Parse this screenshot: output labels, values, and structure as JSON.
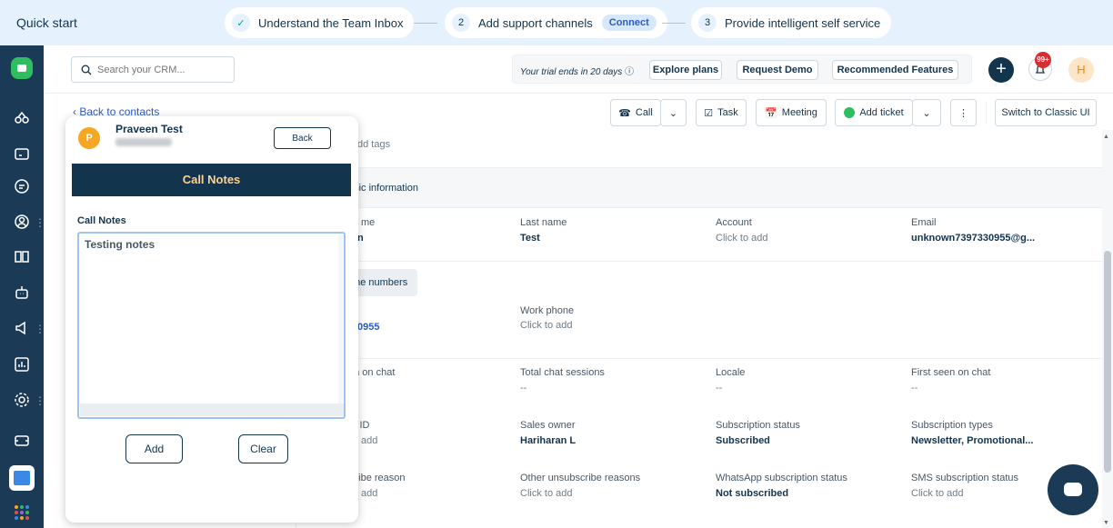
{
  "quickstart": {
    "title": "Quick start",
    "step1": "Understand the Team Inbox",
    "step2_num": "2",
    "step2": "Add support channels",
    "step2_badge": "Connect",
    "step3_num": "3",
    "step3": "Provide intelligent self service"
  },
  "header": {
    "search_placeholder": "Search your CRM...",
    "trial_text": "Your trial ends in 20 days",
    "explore": "Explore plans",
    "demo": "Request Demo",
    "features": "Recommended Features",
    "notif_count": "99+",
    "avatar_initial": "H"
  },
  "toolbar": {
    "back": "Back to contacts",
    "call": "Call",
    "task": "Task",
    "meeting": "Meeting",
    "add_ticket": "Add ticket",
    "classic": "Switch to Classic UI"
  },
  "contact": {
    "add_tags": "dd tags",
    "basic_info": "asic information",
    "first_name_label": "me",
    "first_name_value": "n",
    "last_name_label": "Last name",
    "last_name_value": "Test",
    "account_label": "Account",
    "account_value": "Click to add",
    "email_label": "Email",
    "email_value": "unknown7397330955@g...",
    "phone_numbers": "one numbers",
    "mobile_value": "0955",
    "work_phone_label": "Work phone",
    "work_phone_value": "Click to add",
    "last_seen_label": "en on chat",
    "total_chat_label": "Total chat sessions",
    "total_chat_value": "--",
    "locale_label": "Locale",
    "locale_value": "--",
    "first_seen_label": "First seen on chat",
    "first_seen_value": "--",
    "id_label": "l ID",
    "id_value": "add",
    "sales_owner_label": "Sales owner",
    "sales_owner_value": "Hariharan L",
    "sub_status_label": "Subscription status",
    "sub_status_value": "Subscribed",
    "sub_types_label": "Subscription types",
    "sub_types_value": "Newsletter, Promotional...",
    "unsub_reason_label": "cribe reason",
    "unsub_reason_value": "add",
    "other_unsub_label": "Other unsubscribe reasons",
    "other_unsub_value": "Click to add",
    "wa_sub_label": "WhatsApp subscription status",
    "wa_sub_value": "Not subscribed",
    "sms_sub_label": "SMS subscription status",
    "sms_sub_value": "Click to add"
  },
  "popup": {
    "avatar": "P",
    "name": "Praveen Test",
    "back": "Back",
    "band": "Call Notes",
    "label": "Call Notes",
    "notes": "Testing notes",
    "add": "Add",
    "clear": "Clear"
  },
  "colors": {
    "nav_bg": "#1b3a55",
    "brand_green": "#2ebd5f",
    "link_blue": "#2c5cc5",
    "band_bg": "#12344d",
    "band_text": "#ffd28e"
  }
}
